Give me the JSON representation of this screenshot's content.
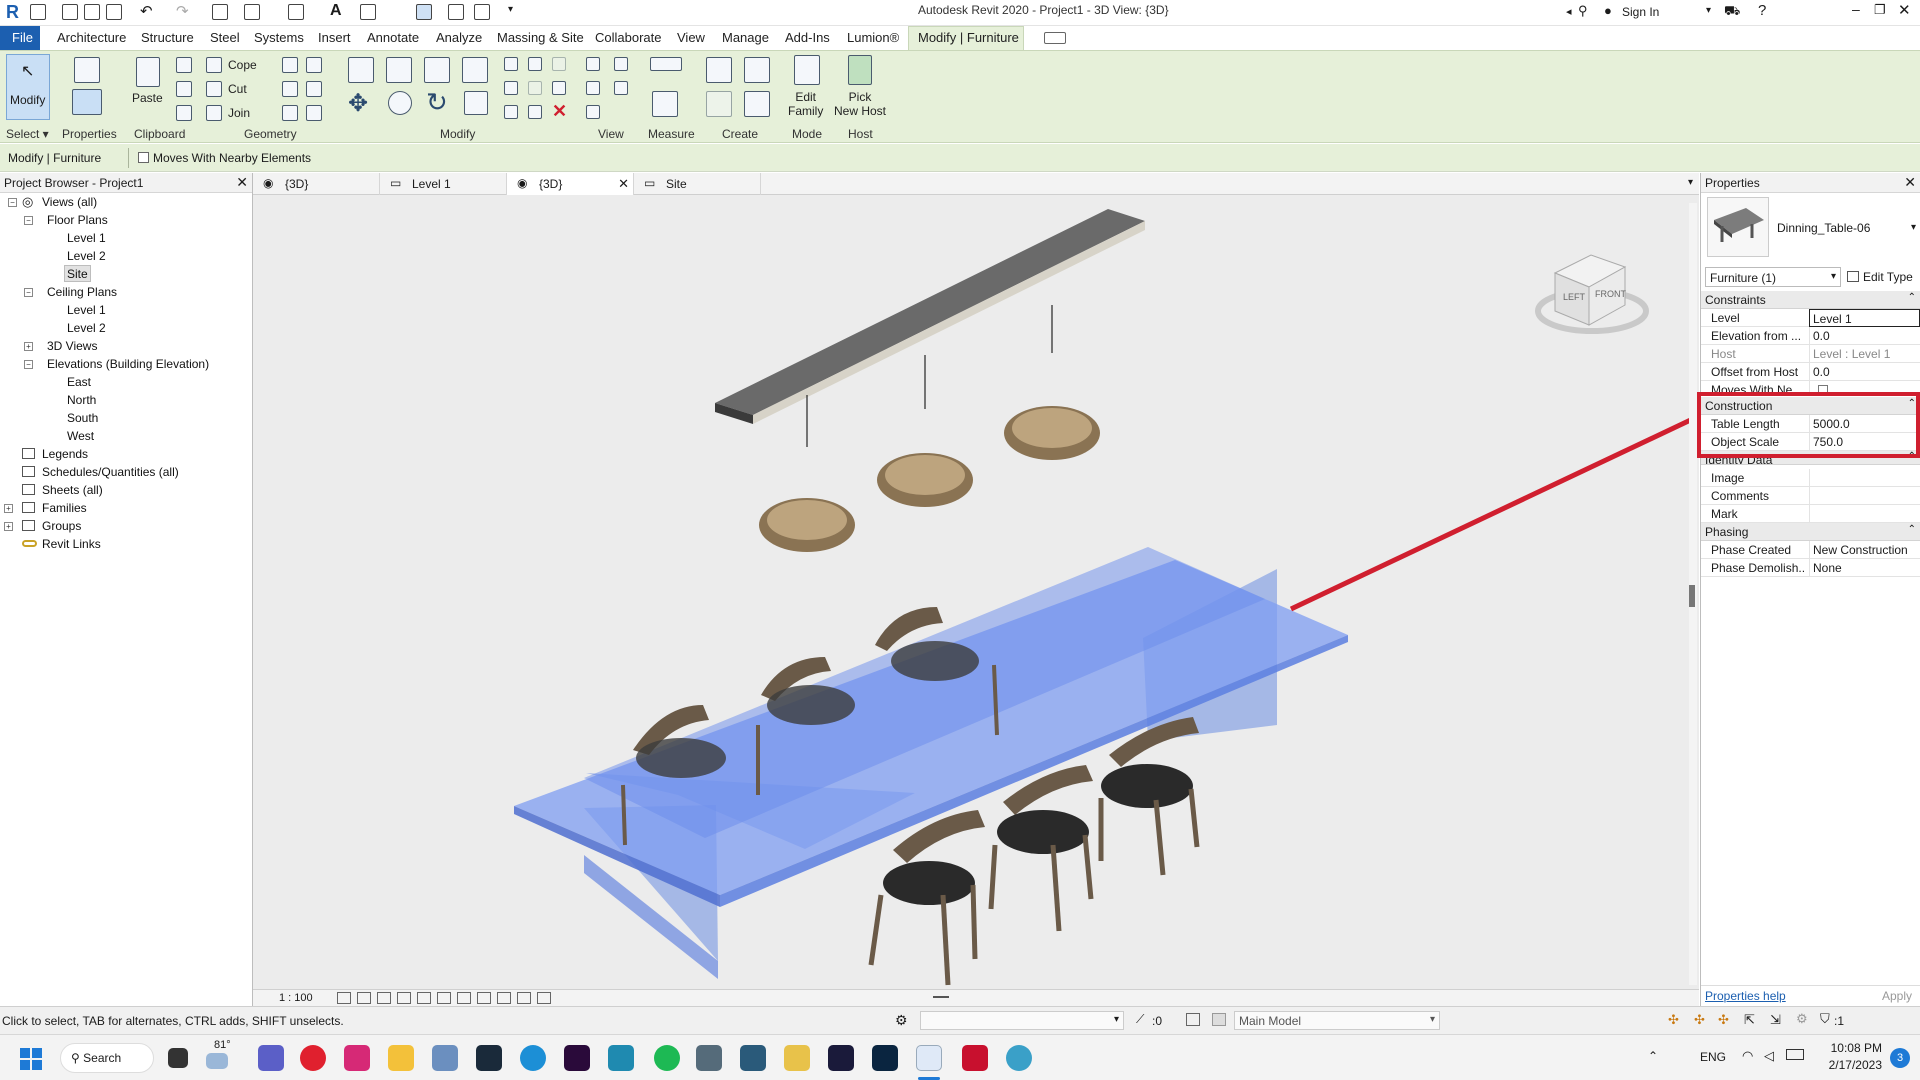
{
  "app": {
    "title": "Autodesk Revit 2020 - Project1 - 3D View: {3D}",
    "sign_in": "Sign In"
  },
  "ribbon_tabs": [
    "File",
    "Architecture",
    "Structure",
    "Steel",
    "Systems",
    "Insert",
    "Annotate",
    "Analyze",
    "Massing & Site",
    "Collaborate",
    "View",
    "Manage",
    "Add-Ins",
    "Lumion®",
    "Modify | Furniture"
  ],
  "ribbon": {
    "modify": "Modify",
    "properties": "Properties",
    "paste": "Paste",
    "cope": "Cope",
    "cut": "Cut",
    "join": "Join",
    "edit_family": "Edit\nFamily",
    "pick_new_host": "Pick\nNew Host",
    "panels": [
      "Select ▾",
      "Properties",
      "Clipboard",
      "Geometry",
      "Modify",
      "View",
      "Measure",
      "Create",
      "Mode",
      "Host"
    ]
  },
  "optionsbar": {
    "context": "Modify | Furniture",
    "checkbox": "Moves With Nearby Elements"
  },
  "browser": {
    "title": "Project Browser - Project1",
    "items": [
      "Views (all)",
      "Floor Plans",
      "Level 1",
      "Level 2",
      "Site",
      "Ceiling Plans",
      "Level 1",
      "Level 2",
      "3D Views",
      "Elevations (Building Elevation)",
      "East",
      "North",
      "South",
      "West",
      "Legends",
      "Schedules/Quantities (all)",
      "Sheets (all)",
      "Families",
      "Groups",
      "Revit Links"
    ]
  },
  "view_tabs": [
    "{3D}",
    "Level 1",
    "{3D}",
    "Site"
  ],
  "viewcube": {
    "left": "LEFT",
    "front": "FRONT"
  },
  "view_status": {
    "scale": "1 : 100"
  },
  "properties": {
    "title": "Properties",
    "family": "Dinning_Table-06",
    "selector": "Furniture (1)",
    "edit_type": "Edit Type",
    "sections": {
      "constraints": "Constraints",
      "construction": "Construction",
      "identity": "Identity Data",
      "phasing": "Phasing"
    },
    "rows": [
      {
        "k": "Level",
        "v": "Level 1"
      },
      {
        "k": "Elevation from ...",
        "v": "0.0"
      },
      {
        "k": "Host",
        "v": "Level : Level 1"
      },
      {
        "k": "Offset from Host",
        "v": "0.0"
      },
      {
        "k": "Moves With Ne...",
        "v": ""
      },
      {
        "k": "Table Length",
        "v": "5000.0"
      },
      {
        "k": "Object Scale",
        "v": "750.0"
      },
      {
        "k": "Image",
        "v": ""
      },
      {
        "k": "Comments",
        "v": ""
      },
      {
        "k": "Mark",
        "v": ""
      },
      {
        "k": "Phase Created",
        "v": "New Construction"
      },
      {
        "k": "Phase Demolish...",
        "v": "None"
      }
    ],
    "help": "Properties help",
    "apply": "Apply"
  },
  "status": {
    "hint": "Click to select, TAB for alternates, CTRL adds, SHIFT unselects.",
    "workset": ":0",
    "model": "Main Model",
    "filter": ":1"
  },
  "taskbar": {
    "weather": "81°",
    "search": "Search",
    "lang": "ENG",
    "time": "10:08 PM",
    "date": "2/17/2023",
    "badge": "3"
  }
}
